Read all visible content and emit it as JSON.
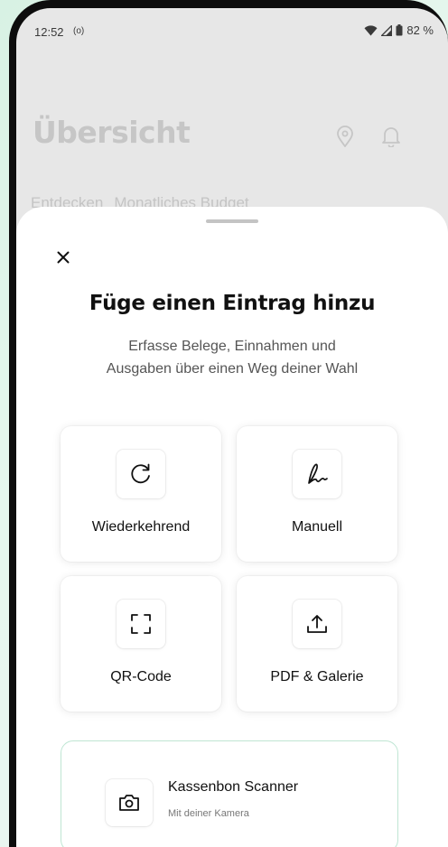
{
  "status_bar": {
    "time": "12:52",
    "left_indicator": "(o)",
    "battery": "82 %"
  },
  "background": {
    "title": "Übersicht",
    "tabs": [
      "Entdecken",
      "Monatliches Budget"
    ]
  },
  "sheet": {
    "title": "Füge einen Eintrag hinzu",
    "subtitle_line1": "Erfasse Belege, Einnahmen und",
    "subtitle_line2": "Ausgaben über einen Weg deiner Wahl",
    "options": [
      {
        "label": "Wiederkehrend",
        "icon": "refresh-icon"
      },
      {
        "label": "Manuell",
        "icon": "signature-icon"
      },
      {
        "label": "QR-Code",
        "icon": "scan-frame-icon"
      },
      {
        "label": "PDF & Galerie",
        "icon": "upload-icon"
      }
    ],
    "scanner": {
      "title": "Kassenbon Scanner",
      "subtitle": "Mit deiner Kamera",
      "icon": "camera-icon"
    }
  },
  "colors": {
    "accent_border": "#bfe6d3",
    "background_gradient": "#d8f2e4"
  }
}
